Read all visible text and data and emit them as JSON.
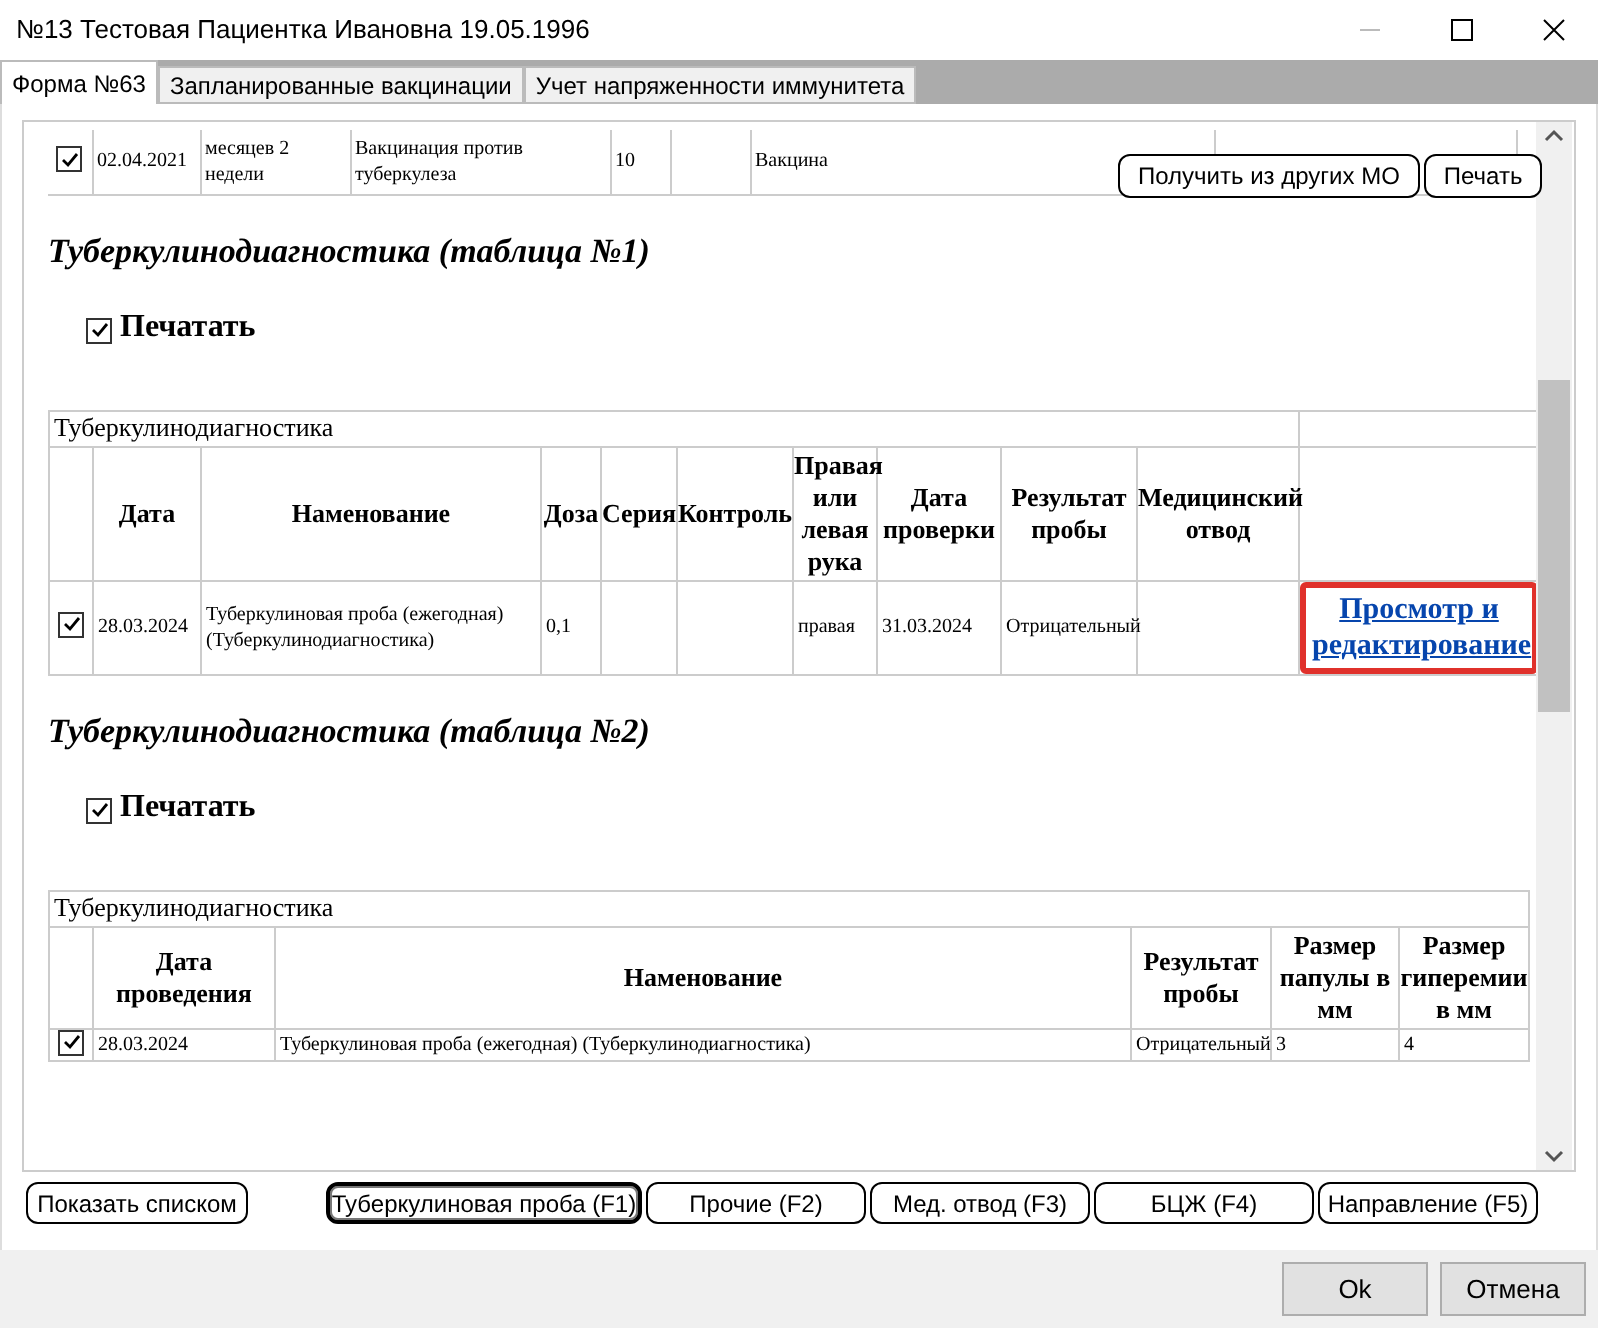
{
  "window": {
    "title": "№13 Тестовая Пациентка Ивановна 19.05.1996"
  },
  "tabs": [
    {
      "label": "Форма №63",
      "selected": true
    },
    {
      "label": "Запланированные вакцинации",
      "selected": false
    },
    {
      "label": "Учет напряженности иммунитета",
      "selected": false
    }
  ],
  "top_row": {
    "checked": true,
    "cells": [
      "02.04.2021",
      "месяцев 2 недели",
      "Вакцинация против туберкулеза",
      "10",
      null,
      "Вакцина",
      null
    ]
  },
  "overlay_buttons": [
    "Получить из других МО",
    "Печать"
  ],
  "sections": [
    {
      "title": "Туберкулинодиагностика (таблица №1)",
      "print": {
        "label": "Печатать",
        "checked": true
      },
      "table": {
        "kind": "full",
        "caption": "Туберкулинодиагностика",
        "columns": [
          "Дата",
          "Наменование",
          "Доза",
          "Серия",
          "Контроль",
          "Правая или левая рука",
          "Дата проверки",
          "Результат пробы",
          "Медицинский отвод"
        ],
        "rows": [
          {
            "checked": true,
            "cells": [
              "28.03.2024",
              "Туберкулиновая проба (ежегодная) (Туберкулинодиагностика)",
              "0,1",
              null,
              null,
              "правая",
              "31.03.2024",
              "Отрицательный",
              null
            ],
            "link": {
              "label": "Просмотр и редактирование",
              "highlighted": true
            }
          }
        ]
      }
    },
    {
      "title": "Туберкулинодиагностика (таблица №2)",
      "print": {
        "label": "Печатать",
        "checked": true
      },
      "table": {
        "kind": "short",
        "caption": "Туберкулинодиагностика",
        "columns": [
          "Дата проведения",
          "Наменование",
          "Результат пробы",
          "Размер папулы в мм",
          "Размер гиперемии в мм"
        ],
        "rows": [
          {
            "checked": true,
            "cells": [
              "28.03.2024",
              "Туберкулиновая проба (ежегодная) (Туберкулинодиагностика)",
              "Отрицательный",
              "3",
              "4"
            ]
          }
        ]
      }
    }
  ],
  "bottom_buttons": [
    {
      "label": "Показать списком",
      "selected": false
    },
    {
      "label": "Туберкулиновая проба (F1)",
      "selected": true
    },
    {
      "label": "Прочие (F2)",
      "selected": false
    },
    {
      "label": "Мед. отвод (F3)",
      "selected": false
    },
    {
      "label": "БЦЖ (F4)",
      "selected": false
    },
    {
      "label": "Направление (F5)",
      "selected": false
    }
  ],
  "footer_buttons": [
    "Ok",
    "Отмена"
  ]
}
